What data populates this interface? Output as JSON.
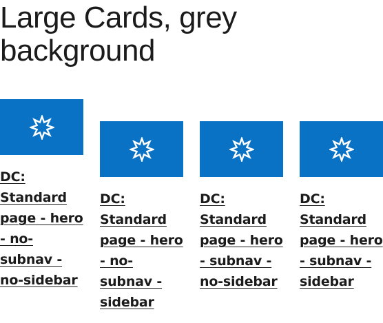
{
  "heading": "Large Cards, grey background",
  "cards": [
    {
      "title": "DC: Standard page - hero - no-subnav - no-sidebar",
      "icon": "sun-burst-icon"
    },
    {
      "title": "DC: Standard page - hero - no-subnav - sidebar",
      "icon": "sun-burst-icon"
    },
    {
      "title": "DC: Standard page - hero - subnav - no-sidebar",
      "icon": "sun-burst-icon"
    },
    {
      "title": "DC: Standard page - hero - subnav - sidebar",
      "icon": "sun-burst-icon"
    }
  ],
  "colors": {
    "card_media_bg": "#0a72c4",
    "icon": "#ffffff",
    "text": "#1b1b1b"
  }
}
